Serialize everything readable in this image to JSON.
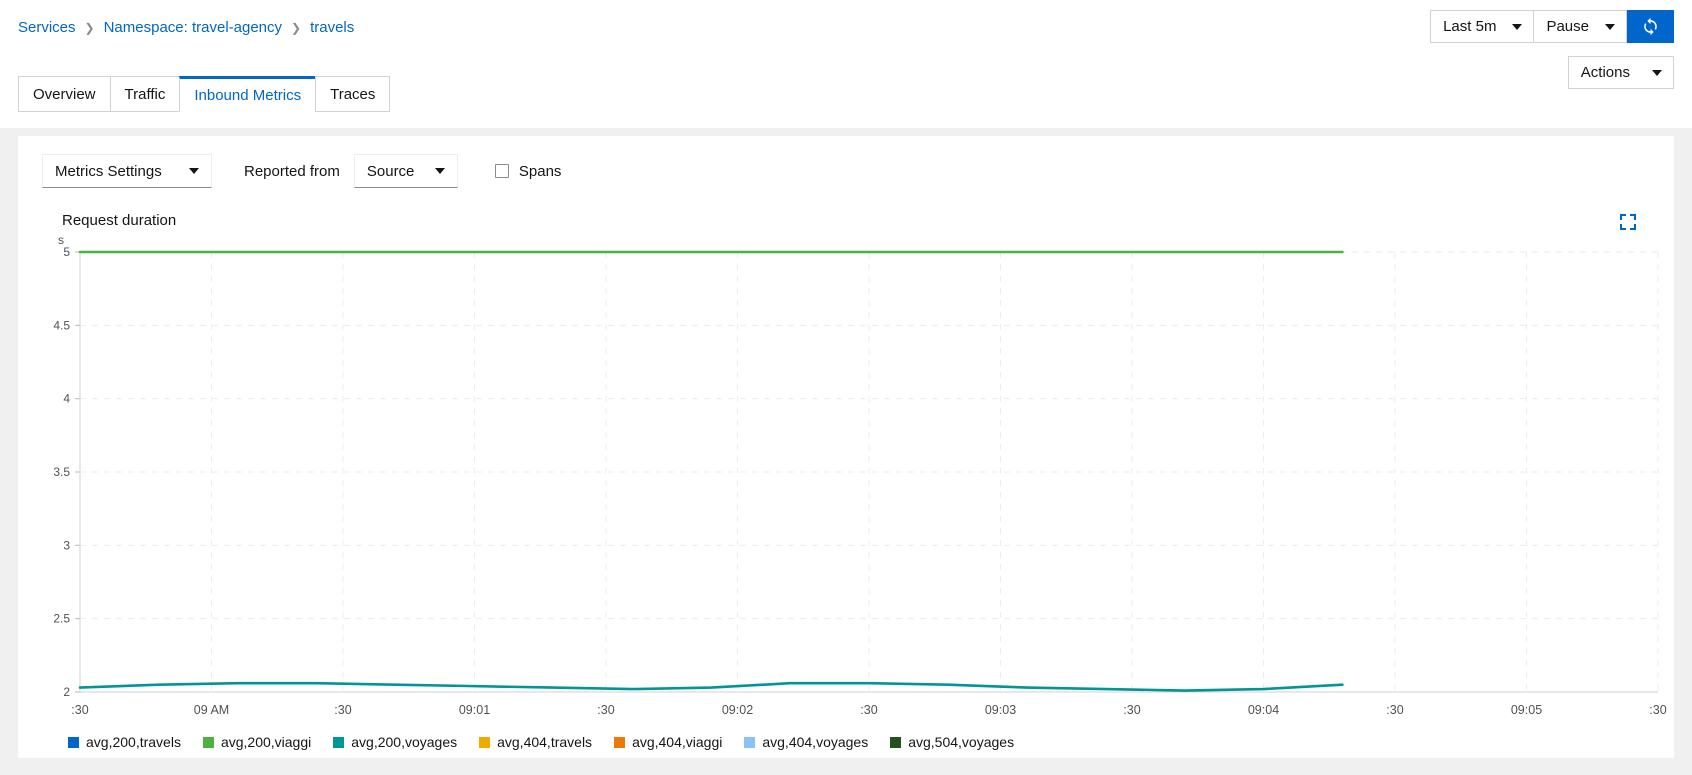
{
  "breadcrumb": {
    "items": [
      {
        "label": "Services"
      },
      {
        "label": "Namespace: travel-agency"
      },
      {
        "label": "travels"
      }
    ],
    "separator": "❯"
  },
  "tabs": [
    {
      "label": "Overview",
      "active": false
    },
    {
      "label": "Traffic",
      "active": false
    },
    {
      "label": "Inbound Metrics",
      "active": true
    },
    {
      "label": "Traces",
      "active": false
    }
  ],
  "topbar": {
    "time_range": "Last 5m",
    "refresh_mode": "Pause",
    "refresh_icon": "refresh-icon",
    "actions_label": "Actions"
  },
  "toolbar": {
    "metrics_settings_label": "Metrics Settings",
    "reported_from_label": "Reported from",
    "reported_from_value": "Source",
    "spans_label": "Spans",
    "spans_checked": false
  },
  "chart_panel": {
    "title": "Request duration",
    "expand_icon": "expand-icon"
  },
  "colors": {
    "accent": "#0066cc",
    "blue": "#0066cc",
    "green": "#4cb140",
    "teal": "#009596",
    "yellow": "#f0ab00",
    "orange": "#ec7a08",
    "light_blue": "#8bc1f7",
    "dark_green": "#23511e",
    "grid": "#ededed",
    "axis_text": "#4f5255"
  },
  "chart_data": {
    "type": "line",
    "title": "Request duration",
    "xlabel": "",
    "ylabel": "s",
    "ylim": [
      2,
      5
    ],
    "yticks": [
      "2",
      "2.5",
      "3",
      "3.5",
      "4",
      "4.5",
      "5"
    ],
    "ytick_values": [
      2,
      2.5,
      3,
      3.5,
      4,
      4.5,
      5
    ],
    "xticks": [
      ":30",
      "09 AM",
      ":30",
      "09:01",
      ":30",
      "09:02",
      ":30",
      "09:03",
      ":30",
      "09:04",
      ":30",
      "09:05",
      ":30"
    ],
    "grid": true,
    "legend_position": "bottom",
    "x": [
      0,
      1,
      2,
      3,
      4,
      5,
      6,
      7,
      8,
      9,
      10,
      11,
      12,
      13,
      14,
      15,
      16,
      17,
      18,
      19,
      20
    ],
    "series": [
      {
        "name": "avg,200,travels",
        "color": "#0066cc",
        "values": [
          null,
          null,
          null,
          null,
          null,
          null,
          null,
          null,
          null,
          null,
          null,
          null,
          null,
          null,
          null,
          null,
          null,
          null,
          null,
          null,
          null
        ]
      },
      {
        "name": "avg,200,viaggi",
        "color": "#4cb140",
        "values": [
          5.0,
          5.0,
          5.0,
          5.0,
          5.0,
          5.0,
          5.0,
          5.0,
          5.0,
          5.0,
          5.0,
          5.0,
          5.0,
          5.0,
          5.0,
          5.0,
          5.0,
          null,
          null,
          null,
          null
        ]
      },
      {
        "name": "avg,200,voyages",
        "color": "#009596",
        "values": [
          2.03,
          2.05,
          2.06,
          2.06,
          2.05,
          2.04,
          2.03,
          2.02,
          2.03,
          2.06,
          2.06,
          2.05,
          2.03,
          2.02,
          2.01,
          2.02,
          2.05,
          null,
          null,
          null,
          null
        ]
      },
      {
        "name": "avg,404,travels",
        "color": "#f0ab00",
        "values": [
          null,
          null,
          null,
          null,
          null,
          null,
          null,
          null,
          null,
          null,
          null,
          null,
          null,
          null,
          null,
          null,
          null,
          null,
          null,
          null,
          null
        ]
      },
      {
        "name": "avg,404,viaggi",
        "color": "#ec7a08",
        "values": [
          null,
          null,
          null,
          null,
          null,
          null,
          null,
          null,
          null,
          null,
          null,
          null,
          null,
          null,
          null,
          null,
          null,
          null,
          null,
          null,
          null
        ]
      },
      {
        "name": "avg,404,voyages",
        "color": "#8bc1f7",
        "values": [
          null,
          null,
          null,
          null,
          null,
          null,
          null,
          null,
          null,
          null,
          null,
          null,
          null,
          null,
          null,
          null,
          null,
          null,
          null,
          null,
          null
        ]
      },
      {
        "name": "avg,504,voyages",
        "color": "#23511e",
        "values": [
          null,
          null,
          null,
          null,
          null,
          null,
          null,
          null,
          null,
          null,
          null,
          null,
          null,
          null,
          null,
          null,
          null,
          null,
          null,
          null,
          null
        ]
      }
    ]
  }
}
